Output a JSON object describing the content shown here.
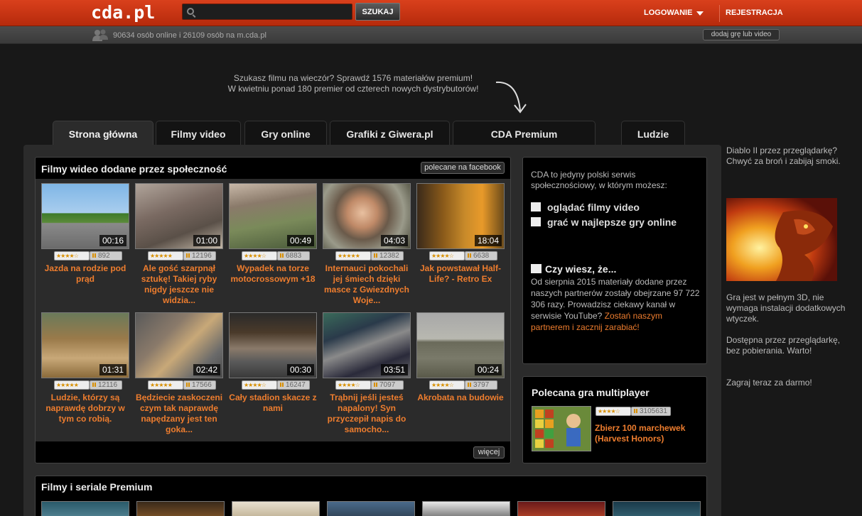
{
  "header": {
    "logo": "cda.pl",
    "search_placeholder": "",
    "search_button": "SZUKAJ",
    "login": "LOGOWANIE",
    "register": "REJESTRACJA"
  },
  "subbar": {
    "online_text": "90634 osób online i 26109 osób na m.cda.pl",
    "add_button": "dodaj grę lub video"
  },
  "promo": {
    "line1": "Szukasz filmu na wieczór? Sprawdź 1576 materiałów premium!",
    "line2": "W kwietniu ponad 180 premier od czterech nowych dystrybutorów!"
  },
  "tabs": [
    {
      "label": "Strona główna",
      "active": true
    },
    {
      "label": "Filmy video"
    },
    {
      "label": "Gry online"
    },
    {
      "label": "Grafiki z Giwera.pl"
    },
    {
      "label": "CDA Premium"
    },
    {
      "label": "Ludzie"
    }
  ],
  "videos": {
    "title": "Filmy wideo dodane przez społeczność",
    "facebook_button": "polecane na facebook",
    "more_button": "więcej",
    "items": [
      {
        "duration": "00:16",
        "stars": "★★★★☆",
        "views": "892",
        "title": "Jazda na rodzie pod prąd"
      },
      {
        "duration": "01:00",
        "stars": "★★★★★",
        "views": "12196",
        "title": "Ale gość szarpnął sztukę! Takiej ryby nigdy jeszcze nie widzia..."
      },
      {
        "duration": "00:49",
        "stars": "★★★★☆",
        "views": "6883",
        "title": "Wypadek na torze motocrossowym +18"
      },
      {
        "duration": "04:03",
        "stars": "★★★★★",
        "views": "12382",
        "title": "Internauci pokochali jej śmiech dzięki masce z Gwiezdnych Woje..."
      },
      {
        "duration": "18:04",
        "stars": "★★★★☆",
        "views": "6638",
        "title": "Jak powstawał Half-Life? - Retro Ex"
      },
      {
        "duration": "01:31",
        "stars": "★★★★★",
        "views": "12116",
        "title": "Ludzie, którzy są naprawdę dobrzy w tym co robią."
      },
      {
        "duration": "02:42",
        "stars": "★★★★★",
        "views": "17566",
        "title": "Będziecie zaskoczeni czym tak naprawdę napędzany jest ten goka..."
      },
      {
        "duration": "00:30",
        "stars": "★★★★☆",
        "views": "16247",
        "title": "Cały stadion skacze z nami"
      },
      {
        "duration": "03:51",
        "stars": "★★★★☆",
        "views": "7097",
        "title": "Trąbnij jeśli jesteś napalony! Syn przyczepił napis do samocho..."
      },
      {
        "duration": "00:24",
        "stars": "★★★★☆",
        "views": "3797",
        "title": "Akrobata na budowie"
      }
    ]
  },
  "info": {
    "intro": "CDA to jedyny polski serwis społecznościowy, w którym możesz:",
    "feature1": "oglądać filmy video",
    "feature2": "grać w najlepsze gry online",
    "dyk_title": "Czy wiesz, że...",
    "dyk_text": "Od sierpnia 2015 materiały dodane przez naszych partnerów zostały obejrzane 97 722 306 razy. Prowadzisz ciekawy kanał w serwisie YouTube? ",
    "dyk_link": "Zostań naszym partnerem i zacznij zarabiać!"
  },
  "game": {
    "title": "Polecana gra multiplayer",
    "stars": "★★★★☆",
    "views": "3105631",
    "name": "Zbierz 100 marchewek (Harvest Honors)"
  },
  "premium": {
    "title": "Filmy i seriale Premium"
  },
  "ad": {
    "text1": "Diablo II przez przeglądarkę? Chwyć za broń i zabijaj smoki.",
    "text2": "Gra jest w pełnym 3D, nie wymaga instalacji dodatkowych wtyczek.",
    "text3": "Dostępna przez przeglądarkę, bez pobierania. Warto!",
    "text4": "Zagraj teraz za darmo!"
  }
}
